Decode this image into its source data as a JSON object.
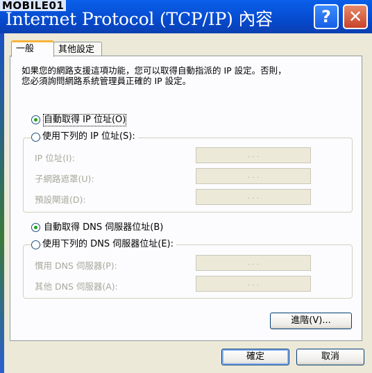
{
  "window": {
    "title": "Internet Protocol (TCP/IP) 內容",
    "watermark": "MOBILE01"
  },
  "titlebar_buttons": {
    "help": "?",
    "close": "✕"
  },
  "tabs": [
    {
      "label": "一般"
    },
    {
      "label": "其他設定"
    }
  ],
  "description": {
    "line1": "如果您的網路支援這項功能，您可以取得自動指派的 IP 設定。否則，",
    "line2": "您必須詢問網路系統管理員正確的 IP 設定。"
  },
  "ip_section": {
    "auto_label": "自動取得 IP 位址(O)",
    "manual_label": "使用下列的 IP 位址(S):",
    "selected": "auto",
    "fields": [
      {
        "label": "IP 位址(I):",
        "value": ". . ."
      },
      {
        "label": "子網路遮罩(U):",
        "value": ". . ."
      },
      {
        "label": "預設閘道(D):",
        "value": ". . ."
      }
    ]
  },
  "dns_section": {
    "auto_label": "自動取得 DNS 伺服器位址(B)",
    "manual_label": "使用下列的 DNS 伺服器位址(E):",
    "selected": "auto",
    "fields": [
      {
        "label": "慣用 DNS 伺服器(P):",
        "value": ". . ."
      },
      {
        "label": "其他 DNS 伺服器(A):",
        "value": ". . ."
      }
    ]
  },
  "buttons": {
    "advanced": "進階(V)...",
    "ok": "確定",
    "cancel": "取消"
  },
  "colors": {
    "titlebar": "#0855dd",
    "dialog_bg": "#ece9d8",
    "panel_bg": "#fcfcfe",
    "radio_dot": "#21a121"
  }
}
